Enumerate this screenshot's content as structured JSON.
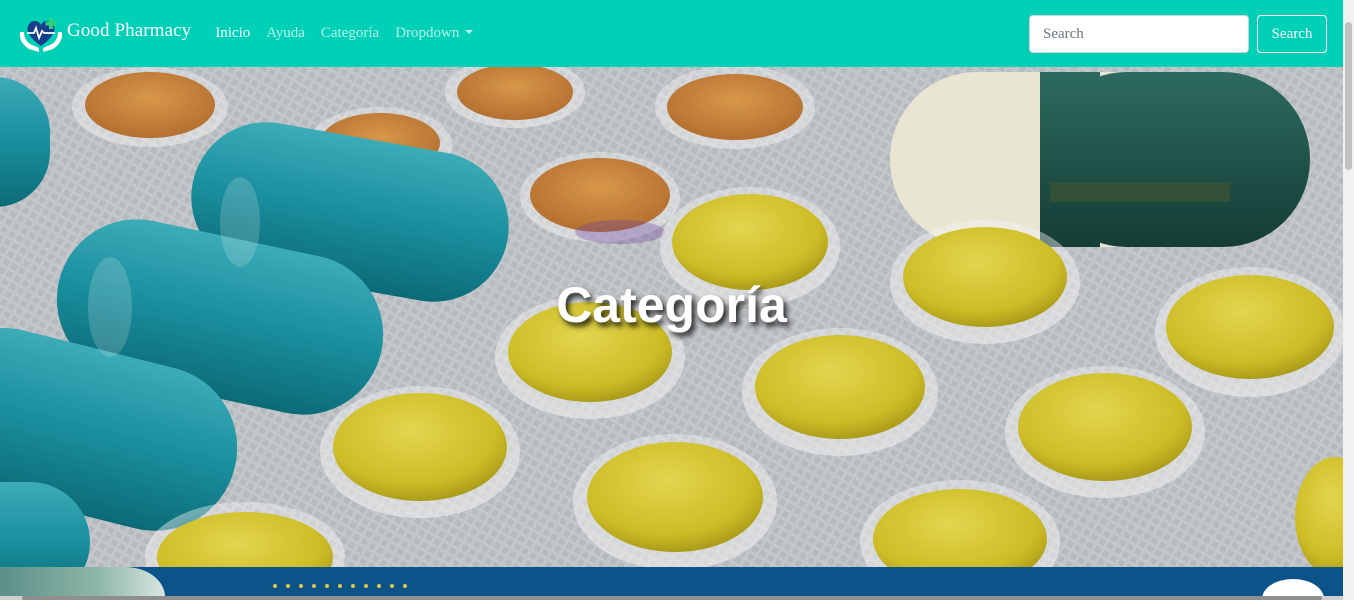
{
  "navbar": {
    "brand_name": "Good Pharmacy",
    "brand_logo": "heart-hands-pulse-logo",
    "links": [
      {
        "label": "Inicio",
        "active": true
      },
      {
        "label": "Ayuda",
        "active": false
      },
      {
        "label": "Categoría",
        "active": false
      },
      {
        "label": "Dropdown",
        "active": false
      }
    ],
    "search": {
      "placeholder": "Search",
      "value": "",
      "button_label": "Search"
    },
    "background_color": "#00d0b6"
  },
  "hero": {
    "title": "Categoría",
    "background_image": "pill blister packs photo (teal capsules, yellow tablets)"
  },
  "footer_strip": {
    "background_color": "#0b5388",
    "dot_color": "#e0c64a"
  }
}
